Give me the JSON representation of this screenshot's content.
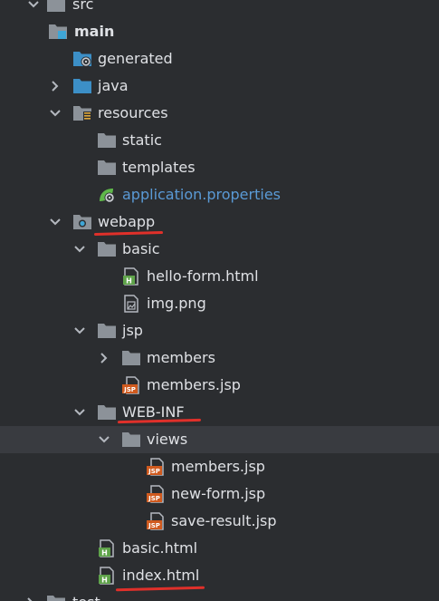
{
  "colors": {
    "background": "#2b2d30",
    "text": "#dfe1e5",
    "property_text": "#5a9ad6",
    "folder": "#8c9299",
    "blue_folder": "#3c8fc7",
    "html_badge": "#5fa34a",
    "jsp_badge": "#d05a1e",
    "selection": "#393b40",
    "annotation": "#e0302a"
  },
  "tree": {
    "src": "src",
    "main": "main",
    "generated": "generated",
    "java": "java",
    "resources": "resources",
    "static": "static",
    "templates": "templates",
    "application_properties": "application.properties",
    "webapp": "webapp",
    "basic": "basic",
    "hello_form": "hello-form.html",
    "img": "img.png",
    "jsp": "jsp",
    "members_dir": "members",
    "members_jsp": "members.jsp",
    "web_inf": "WEB-INF",
    "views": "views",
    "views_members_jsp": "members.jsp",
    "new_form_jsp": "new-form.jsp",
    "save_result_jsp": "save-result.jsp",
    "basic_html": "basic.html",
    "index_html": "index.html",
    "test": "test"
  }
}
